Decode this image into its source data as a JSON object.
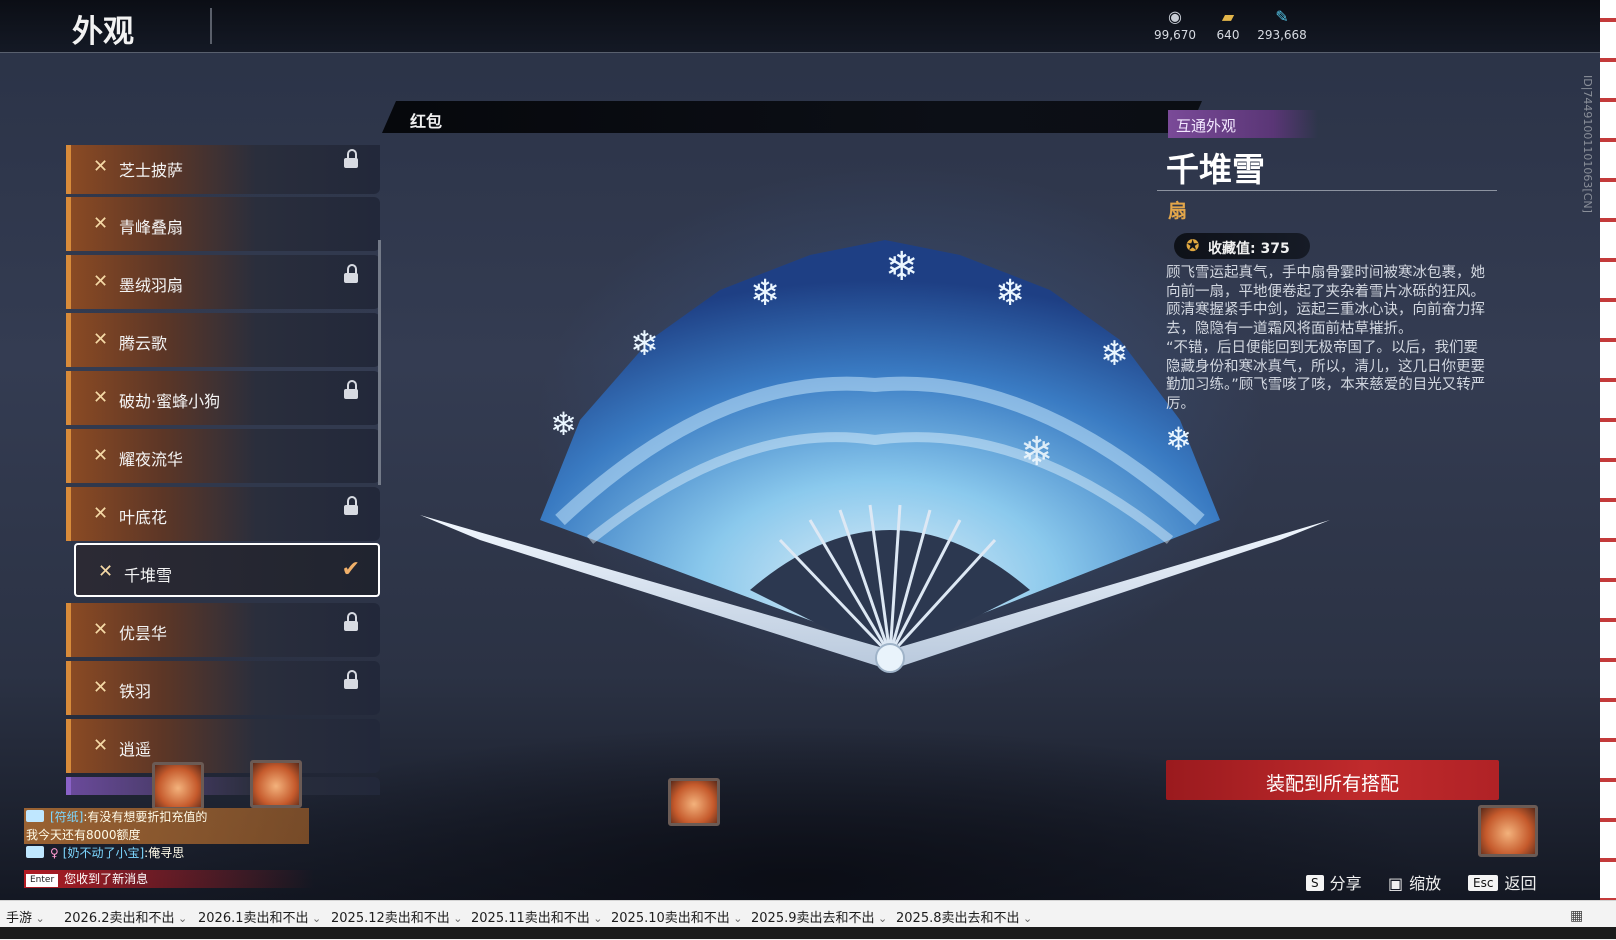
{
  "page": {
    "title": "外观"
  },
  "currencies": [
    {
      "icon": "silver-coin-icon",
      "value": "99,670"
    },
    {
      "icon": "gold-ingot-icon",
      "value": "640"
    },
    {
      "icon": "feather-icon",
      "value": "293,668"
    }
  ],
  "side_id": "ID|74491001101063[CN]",
  "category": {
    "label": "红包"
  },
  "list": {
    "items": [
      {
        "name": "芝士披萨",
        "locked": true
      },
      {
        "name": "青峰叠扇",
        "locked": false
      },
      {
        "name": "墨绒羽扇",
        "locked": true
      },
      {
        "name": "腾云歌",
        "locked": false
      },
      {
        "name": "破劫·蜜蜂小狗",
        "locked": true
      },
      {
        "name": "耀夜流华",
        "locked": false
      },
      {
        "name": "叶底花",
        "locked": true
      },
      {
        "name": "千堆雪",
        "locked": false,
        "selected": true
      },
      {
        "name": "优昙华",
        "locked": true
      },
      {
        "name": "铁羽",
        "locked": true
      },
      {
        "name": "逍遥",
        "locked": false
      }
    ]
  },
  "detail": {
    "tag": "互通外观",
    "name": "千堆雪",
    "type": "扇",
    "collect_label": "收藏值: 375",
    "description": "顾飞雪运起真气，手中扇骨霎时间被寒冰包裹，她向前一扇，平地便卷起了夹杂着雪片冰砾的狂风。顾清寒握紧手中剑，运起三重冰心诀，向前奋力挥去，隐隐有一道霜风将面前枯草摧折。\n“不错，后日便能回到无极帝国了。以后，我们要隐藏身份和寒冰真气，所以，清儿，这几日你更要勤加习练。”顾飞雪咳了咳，本来慈爱的目光又转严厉。",
    "equip_button": "装配到所有搭配"
  },
  "hints": [
    {
      "key": "S",
      "label": "分享"
    },
    {
      "key": "",
      "label": "缩放"
    },
    {
      "key": "Esc",
      "label": "返回"
    }
  ],
  "chat": {
    "messages": [
      {
        "nick": "[符纸]",
        "text": ":有没有想要折扣充值的"
      },
      {
        "nick": "",
        "text": "我今天还有8000额度"
      },
      {
        "nick": "[奶不动了小宝]",
        "text": ":俺寻思"
      }
    ],
    "notice_key": "Enter",
    "notice": "您收到了新消息"
  },
  "taskbar": {
    "tabs": [
      "手游",
      "2026.2卖出和不出",
      "2026.1卖出和不出",
      "2025.12卖出和不出",
      "2025.11卖出和不出",
      "2025.10卖出和不出",
      "2025.9卖出去和不出",
      "2025.8卖出去和不出"
    ]
  }
}
